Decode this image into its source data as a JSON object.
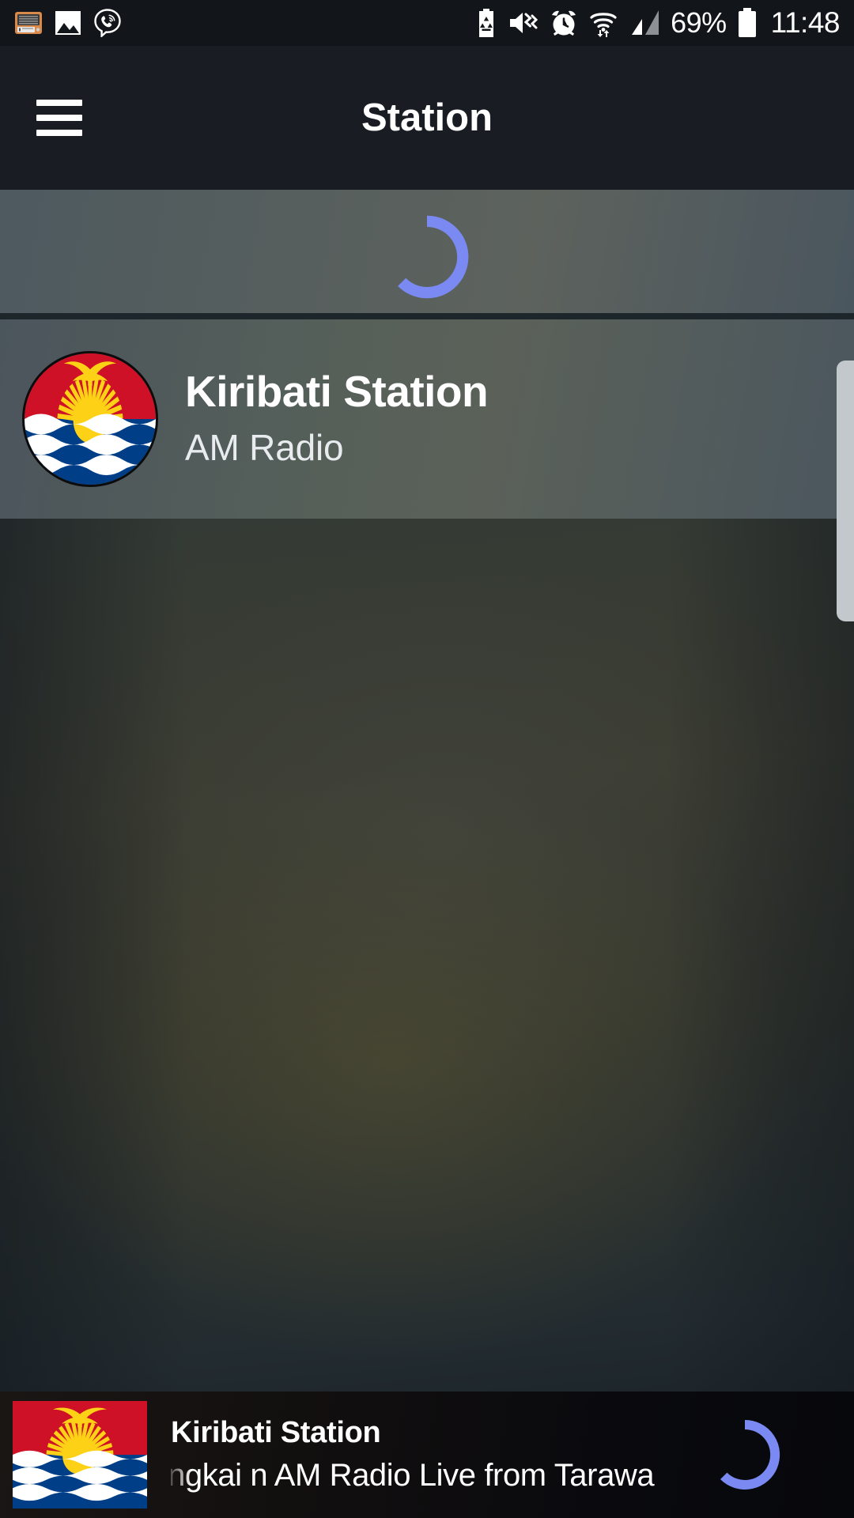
{
  "status_bar": {
    "left_icons": [
      {
        "name": "radio-notification-icon",
        "glyph": "radio"
      },
      {
        "name": "gallery-image-icon",
        "glyph": "image"
      },
      {
        "name": "viber-call-icon",
        "glyph": "viber"
      }
    ],
    "right_icons": [
      {
        "name": "battery-saver-icon",
        "glyph": "battery-saver"
      },
      {
        "name": "sound-mute-vibrate-icon",
        "glyph": "mute"
      },
      {
        "name": "alarm-clock-icon",
        "glyph": "alarm"
      },
      {
        "name": "wifi-data-icon",
        "glyph": "wifi"
      },
      {
        "name": "cellular-signal-icon",
        "glyph": "signal"
      }
    ],
    "battery_percent": "69%",
    "clock": "11:48"
  },
  "app_bar": {
    "menu_icon": "hamburger-menu-icon",
    "title": "Station"
  },
  "list_header": {
    "loading_spinner": "loading-spinner-icon",
    "spinner_color": "#7b8af2"
  },
  "station_row": {
    "flag_icon": "kiribati-flag-icon",
    "name": "Kiribati Station",
    "subtitle": "AM Radio"
  },
  "scrollbar": {
    "thumb": "scrollbar-thumb",
    "color": "#c3c8cc"
  },
  "player": {
    "flag_icon": "kiribati-flag-icon",
    "title": "Kiribati Station",
    "now_playing": "ngkai n AM Radio Live from Tarawa",
    "status_spinner": "loading-spinner-icon",
    "spinner_color": "#7b8af2"
  },
  "theme": {
    "status_bar_bg": "#12161a",
    "app_bar_bg": "#191d23",
    "accent": "#7b8af2",
    "flag_red": "#ce1126",
    "flag_blue": "#003f87",
    "flag_yellow": "#fcd116",
    "flag_white": "#ffffff"
  }
}
